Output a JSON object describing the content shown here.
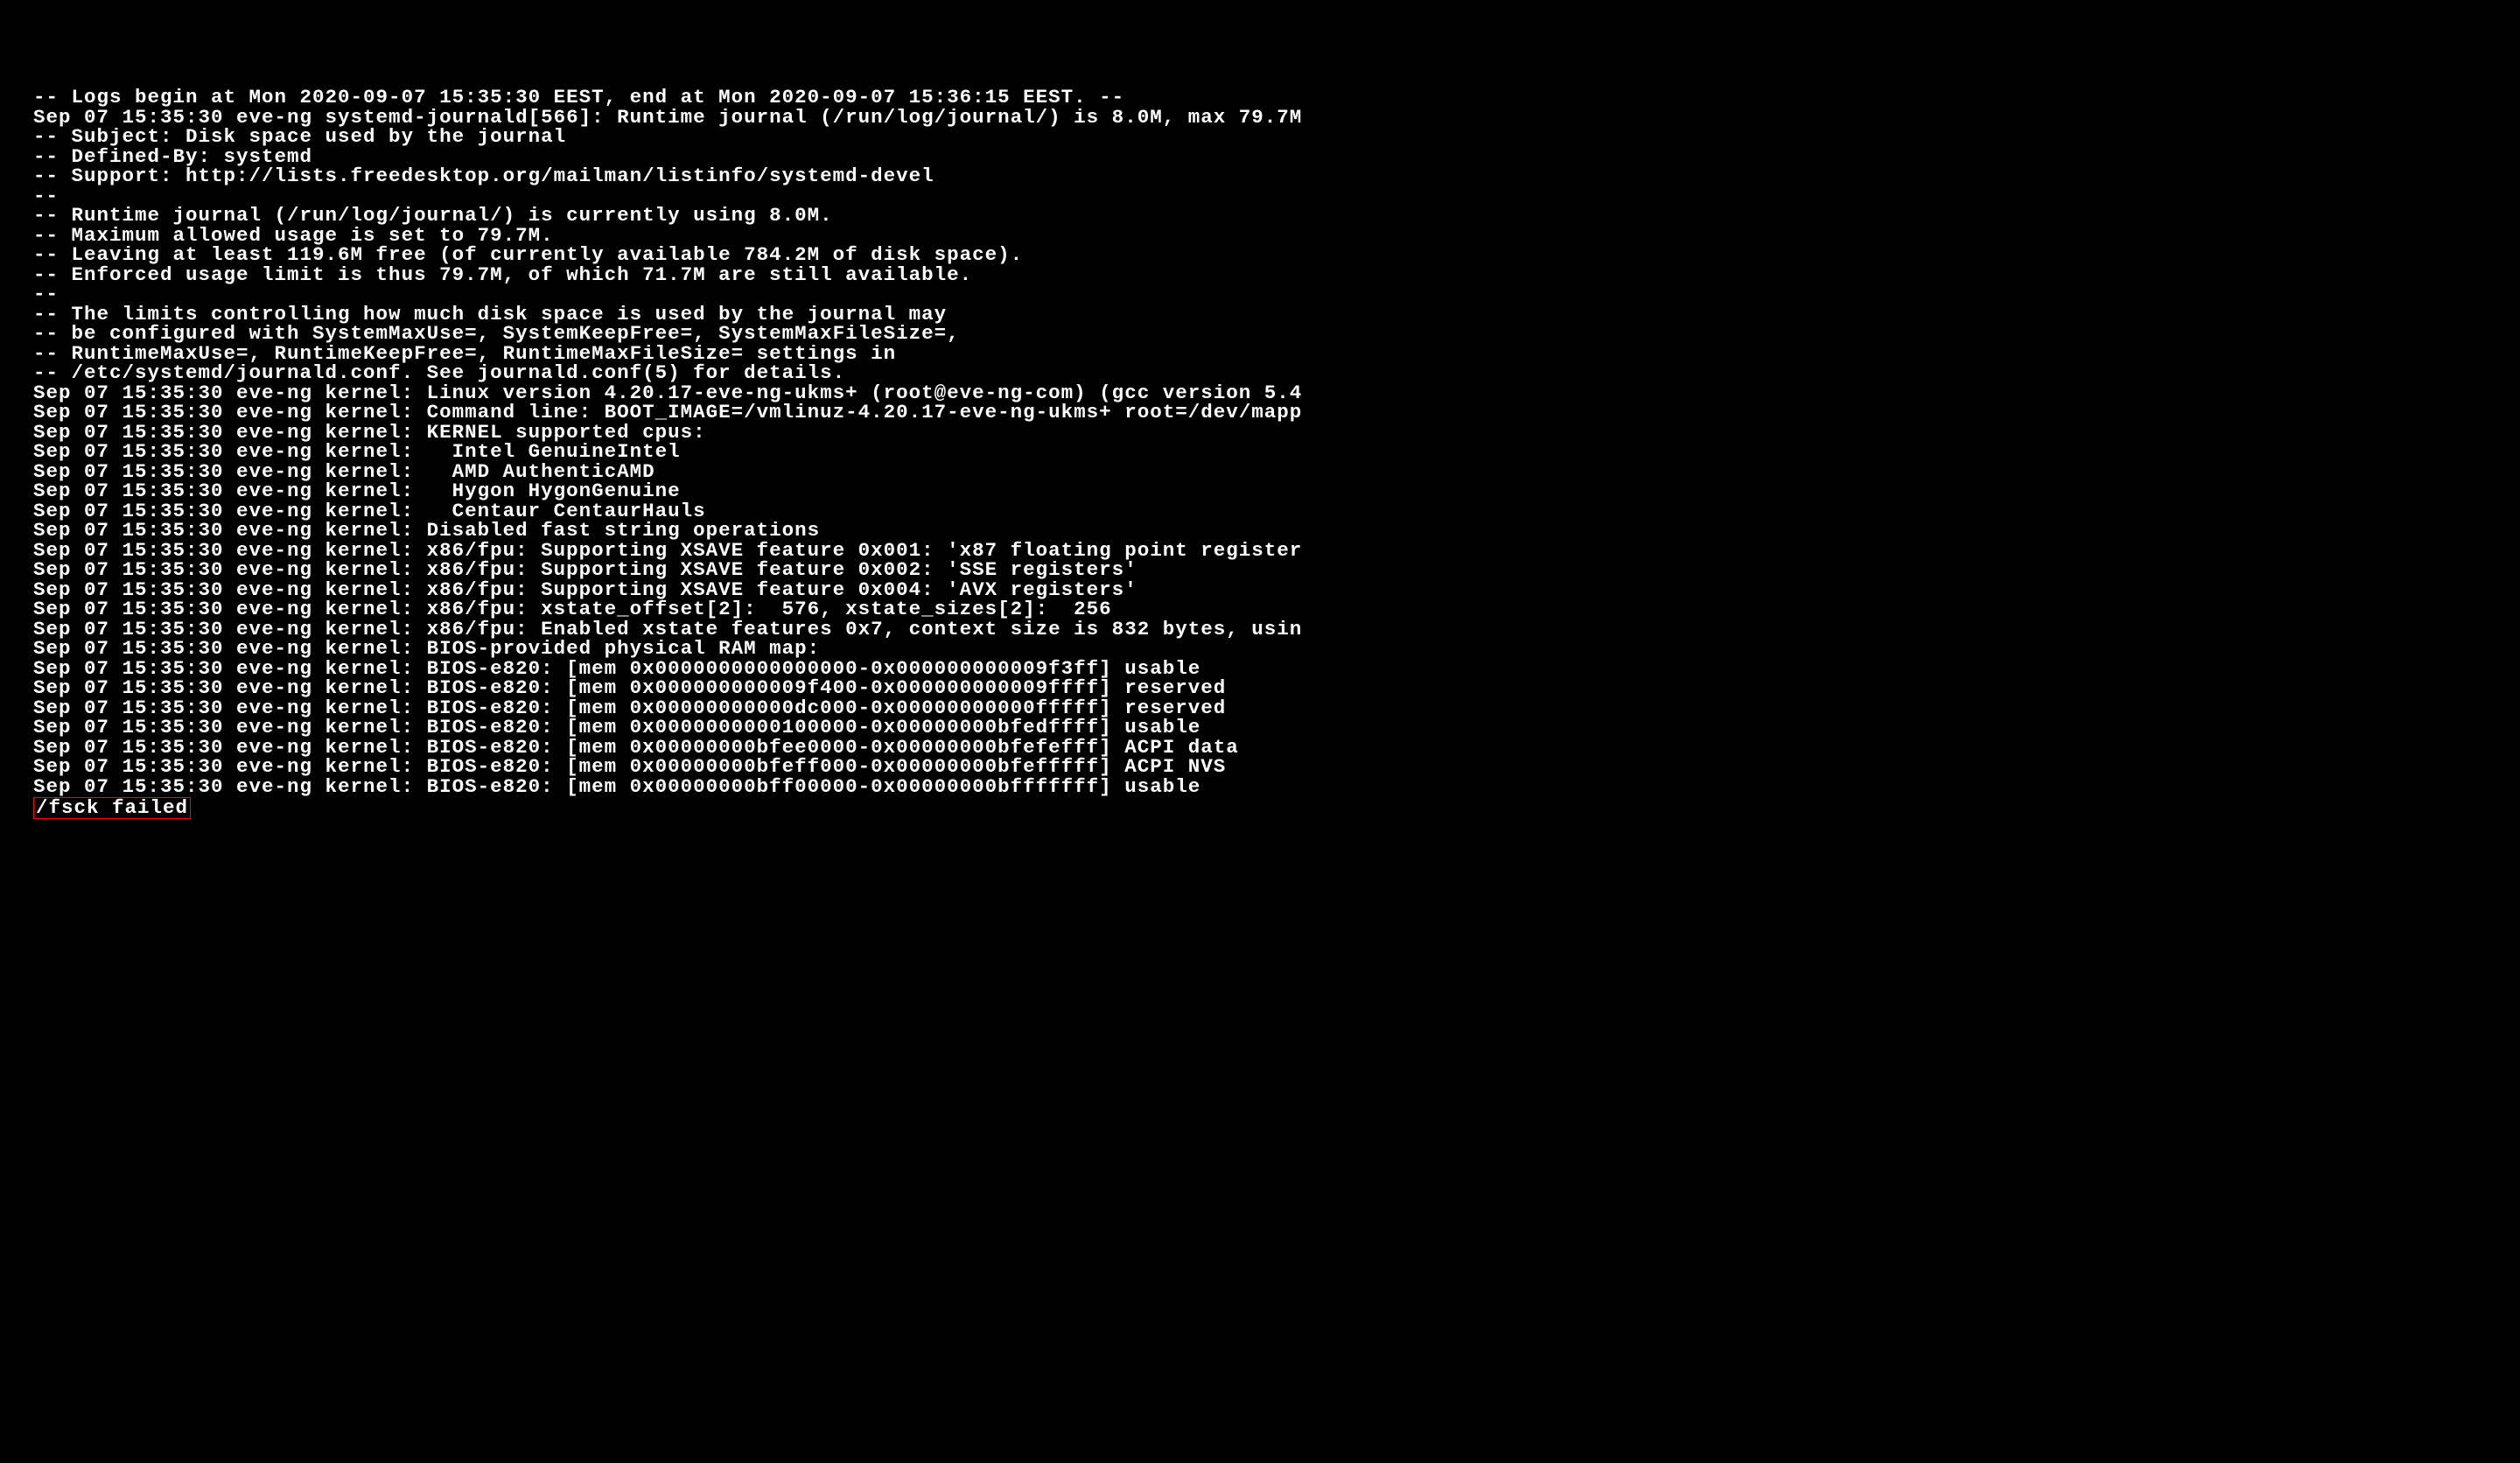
{
  "log_lines": [
    "-- Logs begin at Mon 2020-09-07 15:35:30 EEST, end at Mon 2020-09-07 15:36:15 EEST. --",
    "Sep 07 15:35:30 eve-ng systemd-journald[566]: Runtime journal (/run/log/journal/) is 8.0M, max 79.7M",
    "-- Subject: Disk space used by the journal",
    "-- Defined-By: systemd",
    "-- Support: http://lists.freedesktop.org/mailman/listinfo/systemd-devel",
    "--",
    "-- Runtime journal (/run/log/journal/) is currently using 8.0M.",
    "-- Maximum allowed usage is set to 79.7M.",
    "-- Leaving at least 119.6M free (of currently available 784.2M of disk space).",
    "-- Enforced usage limit is thus 79.7M, of which 71.7M are still available.",
    "--",
    "-- The limits controlling how much disk space is used by the journal may",
    "-- be configured with SystemMaxUse=, SystemKeepFree=, SystemMaxFileSize=,",
    "-- RuntimeMaxUse=, RuntimeKeepFree=, RuntimeMaxFileSize= settings in",
    "-- /etc/systemd/journald.conf. See journald.conf(5) for details.",
    "Sep 07 15:35:30 eve-ng kernel: Linux version 4.20.17-eve-ng-ukms+ (root@eve-ng-com) (gcc version 5.4",
    "Sep 07 15:35:30 eve-ng kernel: Command line: BOOT_IMAGE=/vmlinuz-4.20.17-eve-ng-ukms+ root=/dev/mapp",
    "Sep 07 15:35:30 eve-ng kernel: KERNEL supported cpus:",
    "Sep 07 15:35:30 eve-ng kernel:   Intel GenuineIntel",
    "Sep 07 15:35:30 eve-ng kernel:   AMD AuthenticAMD",
    "Sep 07 15:35:30 eve-ng kernel:   Hygon HygonGenuine",
    "Sep 07 15:35:30 eve-ng kernel:   Centaur CentaurHauls",
    "Sep 07 15:35:30 eve-ng kernel: Disabled fast string operations",
    "Sep 07 15:35:30 eve-ng kernel: x86/fpu: Supporting XSAVE feature 0x001: 'x87 floating point register",
    "Sep 07 15:35:30 eve-ng kernel: x86/fpu: Supporting XSAVE feature 0x002: 'SSE registers'",
    "Sep 07 15:35:30 eve-ng kernel: x86/fpu: Supporting XSAVE feature 0x004: 'AVX registers'",
    "Sep 07 15:35:30 eve-ng kernel: x86/fpu: xstate_offset[2]:  576, xstate_sizes[2]:  256",
    "Sep 07 15:35:30 eve-ng kernel: x86/fpu: Enabled xstate features 0x7, context size is 832 bytes, usin",
    "Sep 07 15:35:30 eve-ng kernel: BIOS-provided physical RAM map:",
    "Sep 07 15:35:30 eve-ng kernel: BIOS-e820: [mem 0x0000000000000000-0x000000000009f3ff] usable",
    "Sep 07 15:35:30 eve-ng kernel: BIOS-e820: [mem 0x000000000009f400-0x000000000009ffff] reserved",
    "Sep 07 15:35:30 eve-ng kernel: BIOS-e820: [mem 0x00000000000dc000-0x00000000000fffff] reserved",
    "Sep 07 15:35:30 eve-ng kernel: BIOS-e820: [mem 0x0000000000100000-0x00000000bfedffff] usable",
    "Sep 07 15:35:30 eve-ng kernel: BIOS-e820: [mem 0x00000000bfee0000-0x00000000bfefefff] ACPI data",
    "Sep 07 15:35:30 eve-ng kernel: BIOS-e820: [mem 0x00000000bfeff000-0x00000000bfefffff] ACPI NVS",
    "Sep 07 15:35:30 eve-ng kernel: BIOS-e820: [mem 0x00000000bff00000-0x00000000bfffffff] usable"
  ],
  "search_term": "/fsck failed"
}
